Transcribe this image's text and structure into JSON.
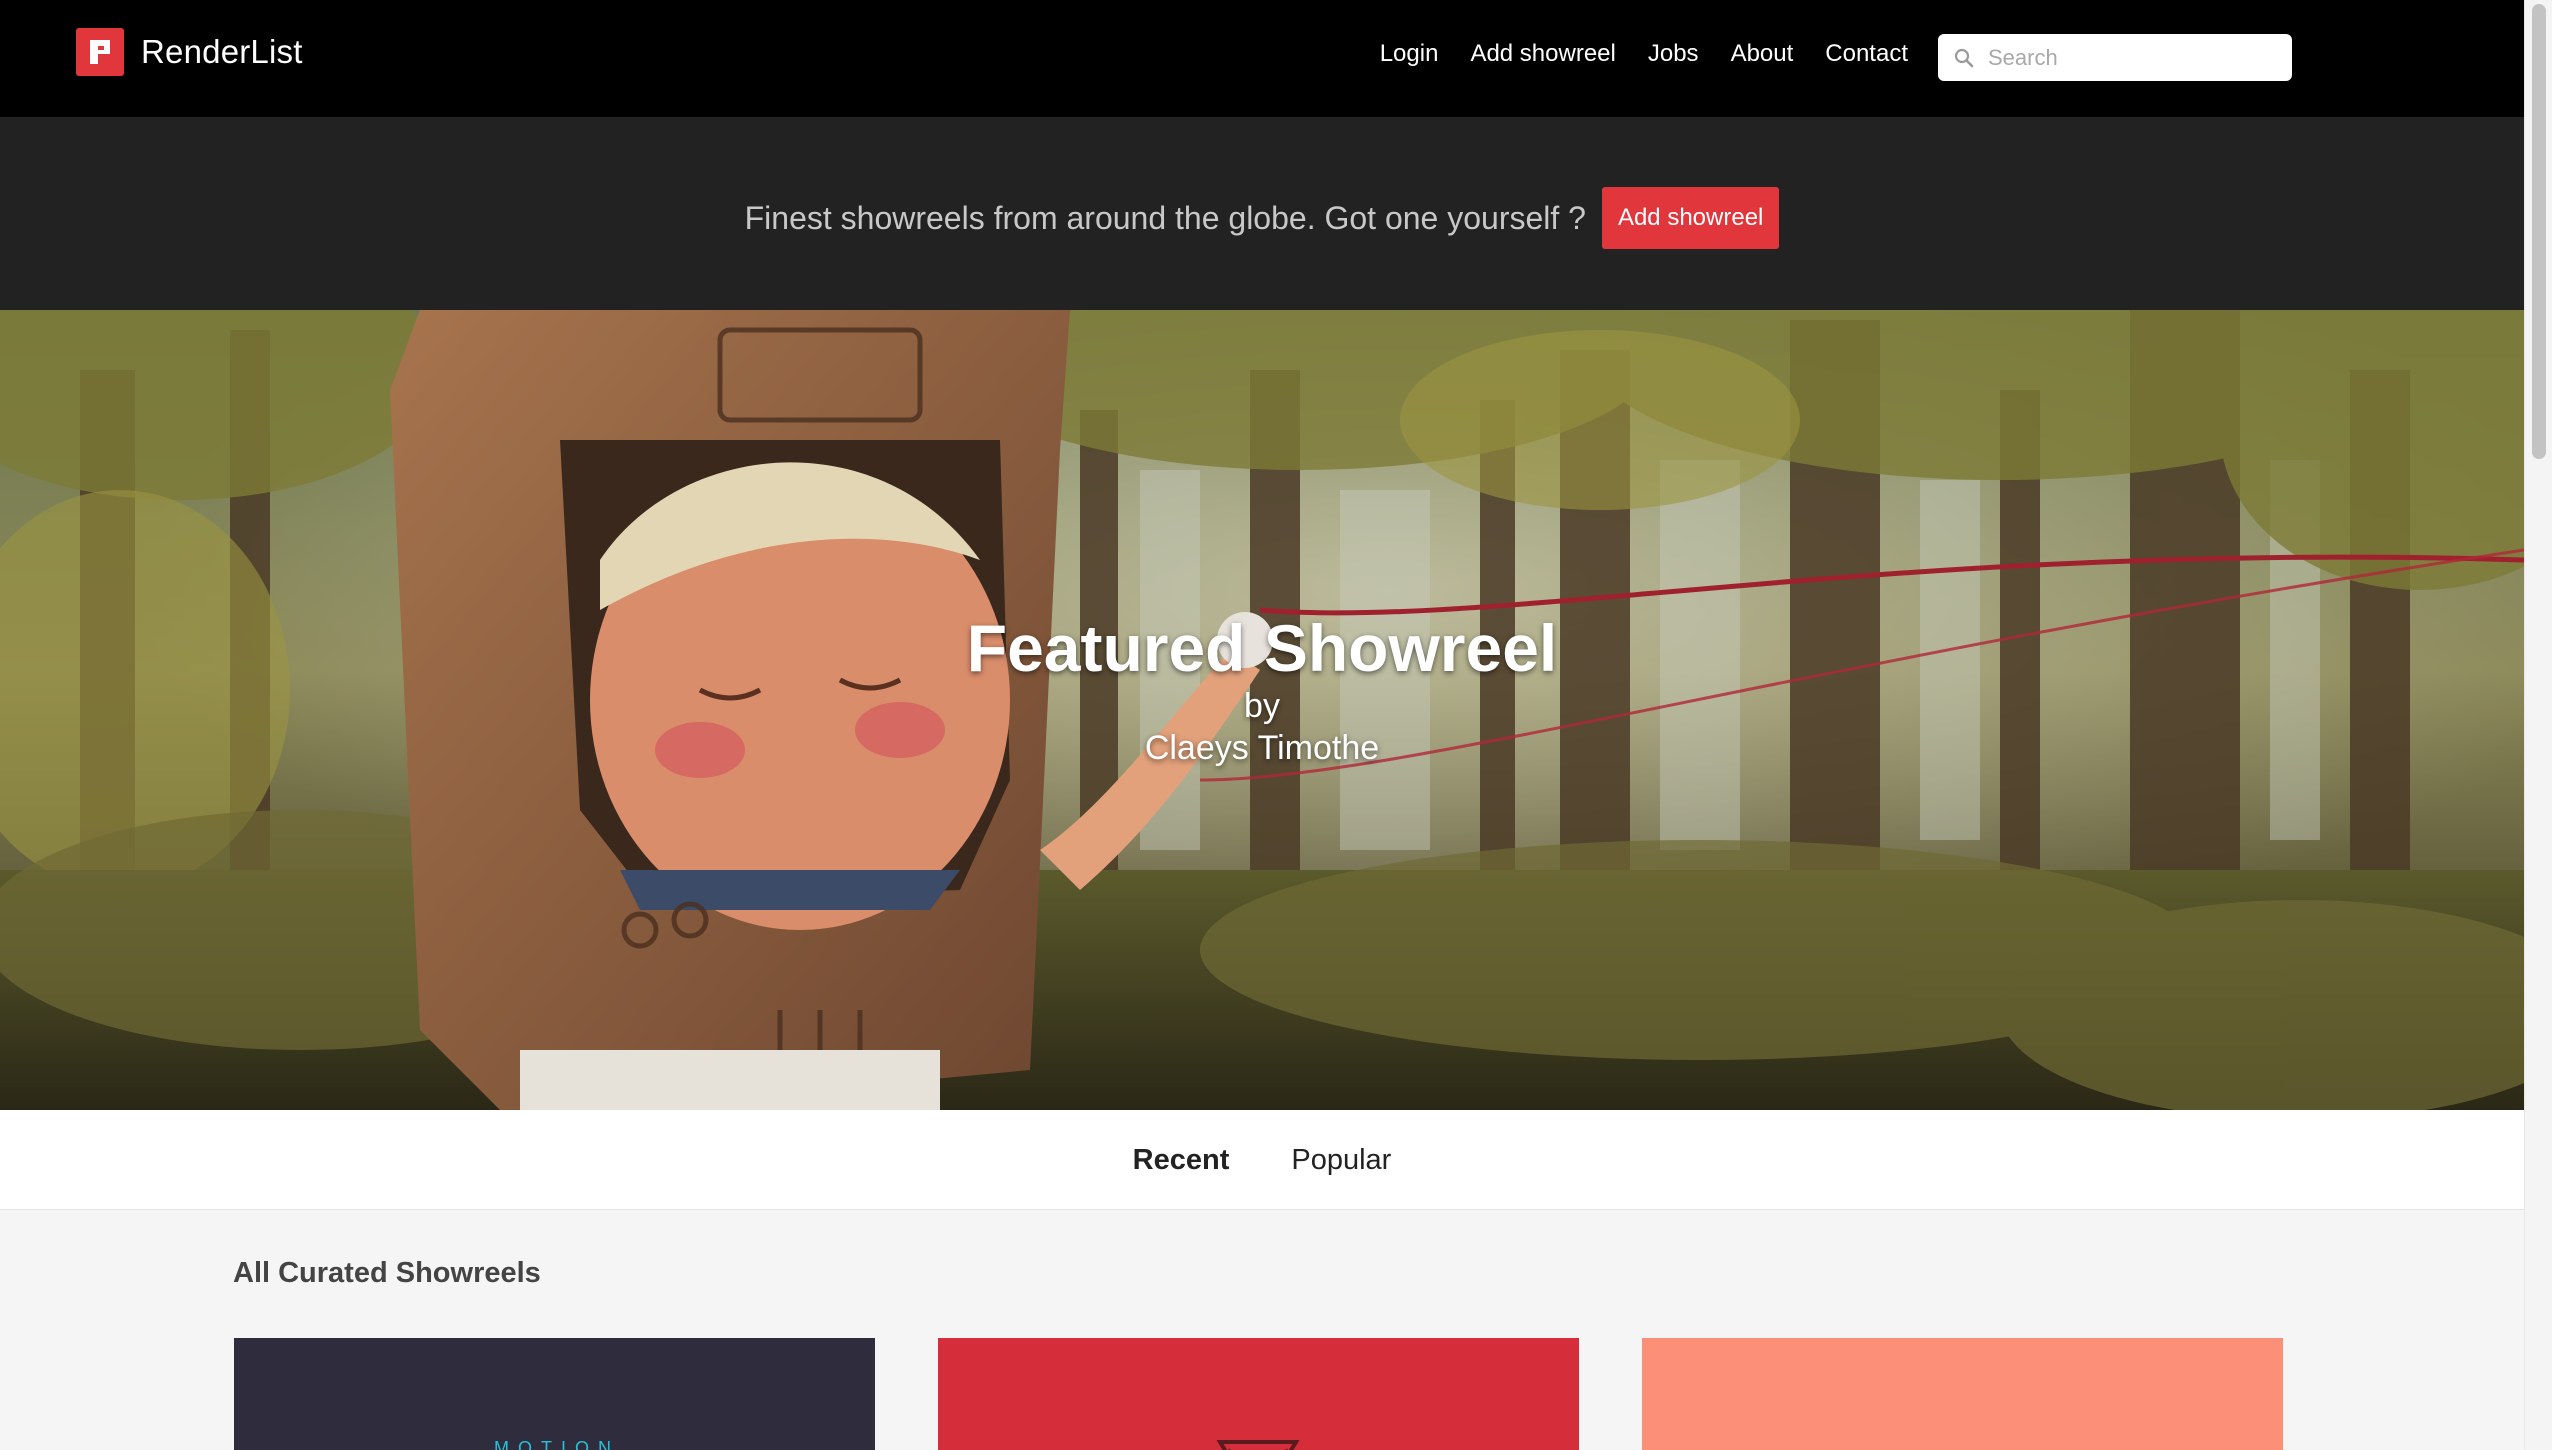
{
  "navbar": {
    "brand": "RenderList",
    "links": [
      "Login",
      "Add showreel",
      "Jobs",
      "About",
      "Contact"
    ],
    "search_placeholder": "Search"
  },
  "tagline": {
    "text": "Finest showreels from around the globe. Got one yourself ?",
    "button": "Add showreel"
  },
  "hero": {
    "title": "Featured Showreel",
    "by": "by",
    "author": "Claeys Timothe"
  },
  "tabs": [
    {
      "label": "Recent",
      "active": true
    },
    {
      "label": "Popular",
      "active": false
    }
  ],
  "section": {
    "title": "All Curated Showreels",
    "cards": [
      {
        "label": "MOTION",
        "color": "#2f2c3e"
      },
      {
        "label": "",
        "color": "#d62d3a"
      },
      {
        "label": "",
        "color": "#fb8f77"
      }
    ]
  },
  "colors": {
    "brand_red": "#e1363c",
    "navbar_bg": "#000000",
    "tagline_bg": "#222222"
  }
}
